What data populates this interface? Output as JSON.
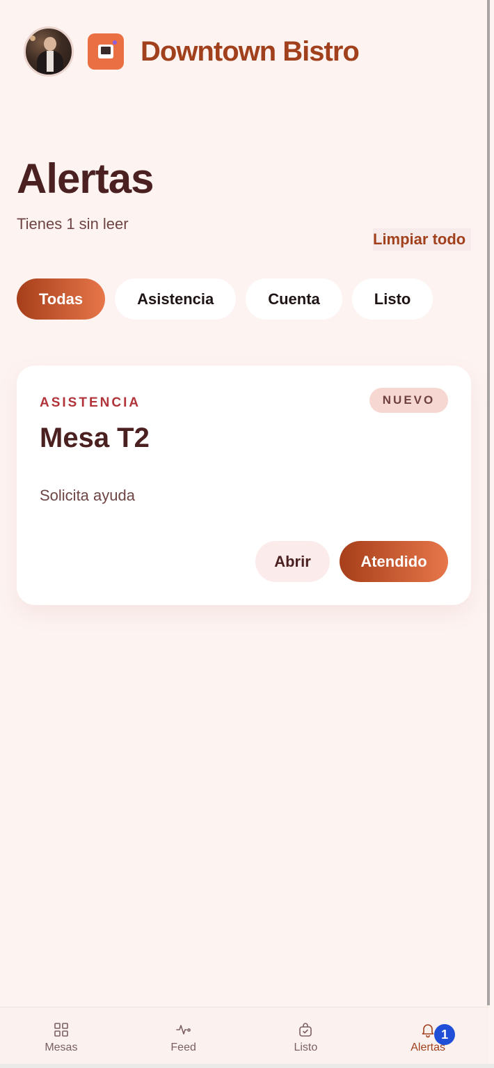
{
  "header": {
    "brand": "Downtown Bistro",
    "avatar_icon": "waiter-photo",
    "logo_icon": "register-icon"
  },
  "page": {
    "title": "Alertas",
    "subtitle": "Tienes 1 sin leer",
    "clear_all_label": "Limpiar todo"
  },
  "filters": [
    {
      "label": "Todas",
      "active": true
    },
    {
      "label": "Asistencia",
      "active": false
    },
    {
      "label": "Cuenta",
      "active": false
    },
    {
      "label": "Listo",
      "active": false
    }
  ],
  "alerts": [
    {
      "type": "ASISTENCIA",
      "badge": "NUEVO",
      "title": "Mesa T2",
      "description": "Solicita ayuda",
      "open_label": "Abrir",
      "done_label": "Atendido"
    }
  ],
  "nav": [
    {
      "label": "Mesas",
      "icon": "grid-icon",
      "active": false
    },
    {
      "label": "Feed",
      "icon": "activity-icon",
      "active": false
    },
    {
      "label": "Listo",
      "icon": "bag-check-icon",
      "active": false
    },
    {
      "label": "Alertas",
      "icon": "bell-icon",
      "active": true,
      "badge": "1"
    }
  ],
  "colors": {
    "accent": "#a1401c",
    "accent_gradient_end": "#e7764a",
    "background": "#fdf3f1",
    "badge_blue": "#1e4fd6"
  }
}
